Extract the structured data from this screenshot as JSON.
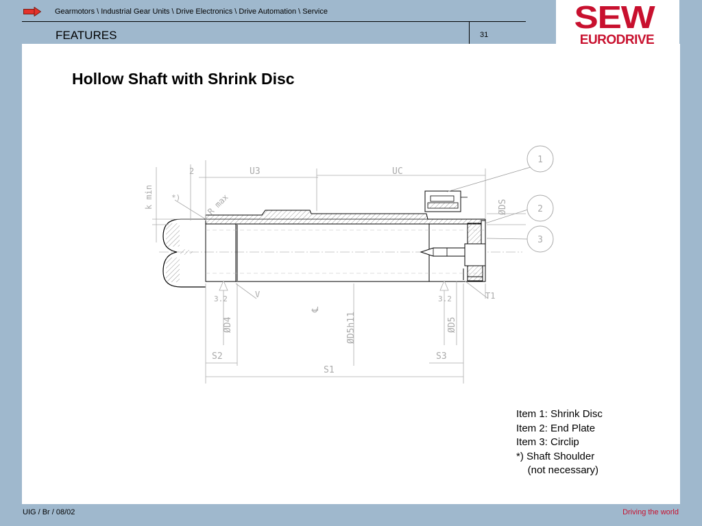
{
  "header": {
    "breadcrumb": "Gearmotors \\ Industrial Gear Units \\ Drive Electronics \\ Drive Automation \\ Service",
    "section": "FEATURES",
    "page_number": "31"
  },
  "logo": {
    "line1": "SEW",
    "line2": "EURODRIVE",
    "color": "#c8102e"
  },
  "slide": {
    "title": "Hollow Shaft with Shrink Disc"
  },
  "drawing": {
    "dims": {
      "kmin": "k min",
      "two": "2",
      "u3": "U3",
      "uc": "UC",
      "star": "*)",
      "rmax": "R max",
      "ds": "ØDS",
      "d4": "ØD4",
      "d5h11": "ØD5h11",
      "d5": "ØD5",
      "v": "V",
      "cl": "℄",
      "r32a": "3.2",
      "r32b": "3.2",
      "t1": "T1",
      "s2": "S2",
      "s3": "S3",
      "s1": "S1"
    },
    "items": [
      "1",
      "2",
      "3"
    ]
  },
  "legend": [
    "Item 1: Shrink Disc",
    "Item 2: End Plate",
    "Item 3: Circlip",
    "*) Shaft Shoulder",
    "    (not necessary)"
  ],
  "footer": {
    "left": "UIG / Br / 08/02",
    "right": "Driving the world"
  },
  "colors": {
    "background": "#9fb8cd",
    "accent": "#c8102e"
  }
}
